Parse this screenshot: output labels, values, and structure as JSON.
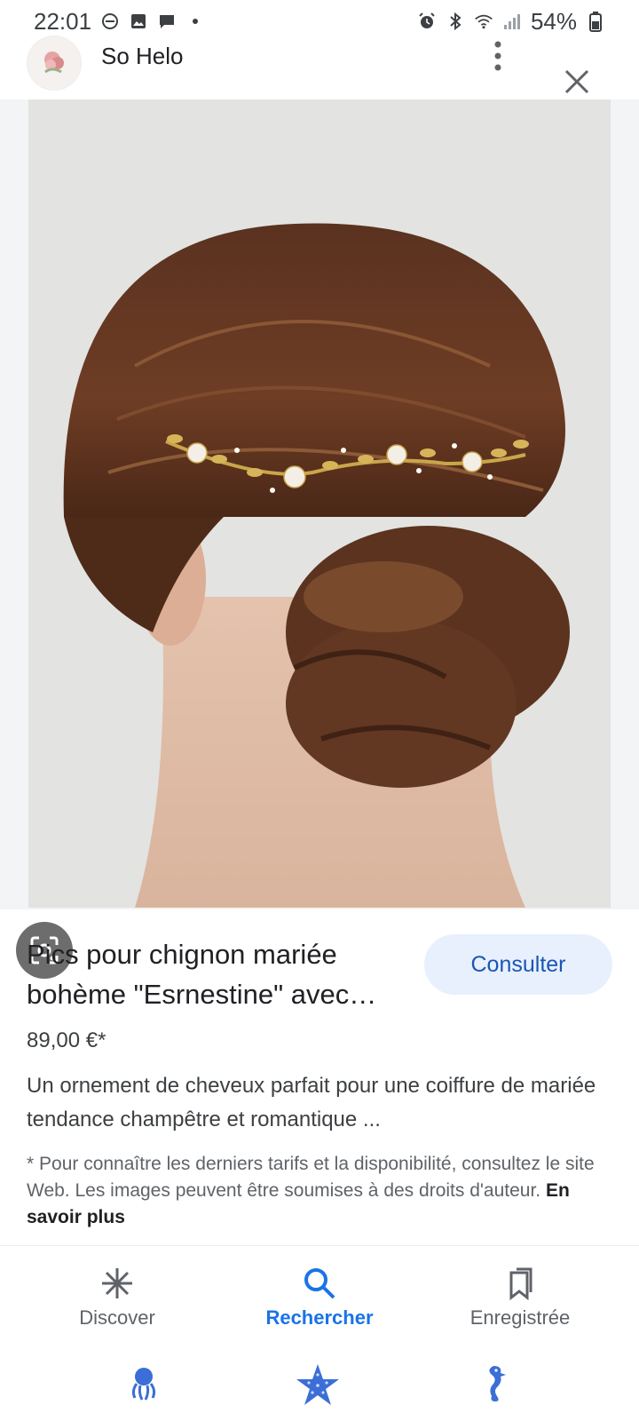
{
  "status_bar": {
    "time": "22:01",
    "left_icons": [
      "do-not-disturb-icon",
      "gallery-icon",
      "message-icon",
      "dot-icon"
    ],
    "right_icons": [
      "alarm-icon",
      "bluetooth-icon",
      "wifi-icon",
      "signal-icon"
    ],
    "battery": "54%"
  },
  "header": {
    "site_name": "So Helo",
    "menu_icon": "more-vertical-icon",
    "close_icon": "close-icon"
  },
  "image": {
    "description_icon": "lens-search-icon"
  },
  "product": {
    "title": "Pics pour chignon mariée bohème \"Esrnestine\" avec…",
    "cta_label": "Consulter",
    "price": "89,00 €*",
    "description": "Un ornement de cheveux parfait pour une coiffure de mariée tendance champêtre et romantique ...",
    "disclaimer": "* Pour connaître les derniers tarifs et la disponibilité, consultez le site Web. Les images peuvent être soumises à des droits d'auteur.",
    "learn_more": "En savoir plus"
  },
  "bottom_nav": {
    "items": [
      {
        "label": "Discover",
        "icon": "discover-icon",
        "active": false
      },
      {
        "label": "Rechercher",
        "icon": "search-icon",
        "active": true
      },
      {
        "label": "Enregistrée",
        "icon": "saved-icon",
        "active": false
      }
    ]
  },
  "system_nav": [
    "octopus-icon",
    "starfish-icon",
    "seahorse-icon"
  ],
  "colors": {
    "accent": "#1a73e8",
    "cta_bg": "#e8f0fe",
    "cta_text": "#1a56b3"
  }
}
